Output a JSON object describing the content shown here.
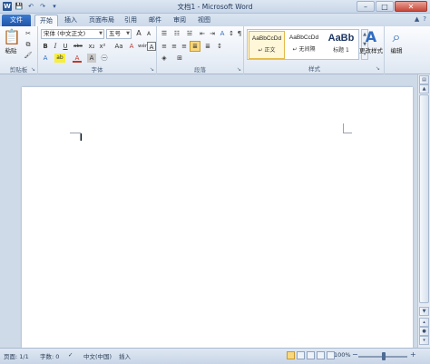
{
  "window": {
    "title": "文档1 - Microsoft Word",
    "buttons": {
      "minimize": "–",
      "maximize": "□",
      "close": "✕"
    }
  },
  "qat": {
    "logo": "W",
    "save": "💾",
    "undo": "↶",
    "redo": "↷",
    "more": "▾"
  },
  "tabs": {
    "file": "文件",
    "items": [
      "开始",
      "插入",
      "页面布局",
      "引用",
      "邮件",
      "审阅",
      "视图"
    ],
    "active": "开始",
    "right_icons": [
      "▲",
      "?"
    ]
  },
  "ribbon": {
    "clipboard": {
      "label": "剪贴板",
      "paste_label": "粘贴",
      "paste_icon": "📋"
    },
    "font": {
      "label": "字体",
      "font_name": "宋体 (中文正文)",
      "font_size": "五号",
      "grow": "A",
      "shrink": "A",
      "aa": "Aa",
      "clear": "A",
      "wen": "wén",
      "A_box": "A",
      "bold": "B",
      "italic": "I",
      "underline": "U",
      "strike": "abc",
      "sub": "x₂",
      "sup": "x²",
      "effects": "A",
      "highlight": "ab",
      "fontcolor": "A",
      "charshade": "A",
      "circle": "㊀"
    },
    "paragraph": {
      "label": "段落",
      "bullets": "☰",
      "numbering": "☷",
      "multilevel": "☱",
      "decrease": "⇤",
      "increase": "⇥",
      "chinese": "A",
      "sort": "↕",
      "marks": "¶",
      "left": "≡",
      "center": "≡",
      "right": "≡",
      "justify": "≣",
      "distributed": "≣",
      "spacing": "↕",
      "shading": "◈",
      "borders": "⊞"
    },
    "styles": {
      "label": "样式",
      "items": [
        {
          "preview": "AaBbCcDd",
          "name": "↵ 正文"
        },
        {
          "preview": "AaBbCcDd",
          "name": "↵ 无间隔"
        },
        {
          "preview": "AaBb",
          "name": "标题 1"
        }
      ],
      "change_styles": "更改样式",
      "change_icon": "A"
    },
    "editing": {
      "label": "编辑",
      "icon": "⌕"
    }
  },
  "status": {
    "page": "页面: 1/1",
    "words": "字数: 0",
    "proof_icon": "✓",
    "language": "中文(中国)",
    "insert": "插入",
    "zoom": "100%",
    "minus": "−",
    "plus": "+"
  },
  "scrollbar": {
    "up": "▲",
    "down": "▼",
    "prev": "▴",
    "next": "▾"
  }
}
